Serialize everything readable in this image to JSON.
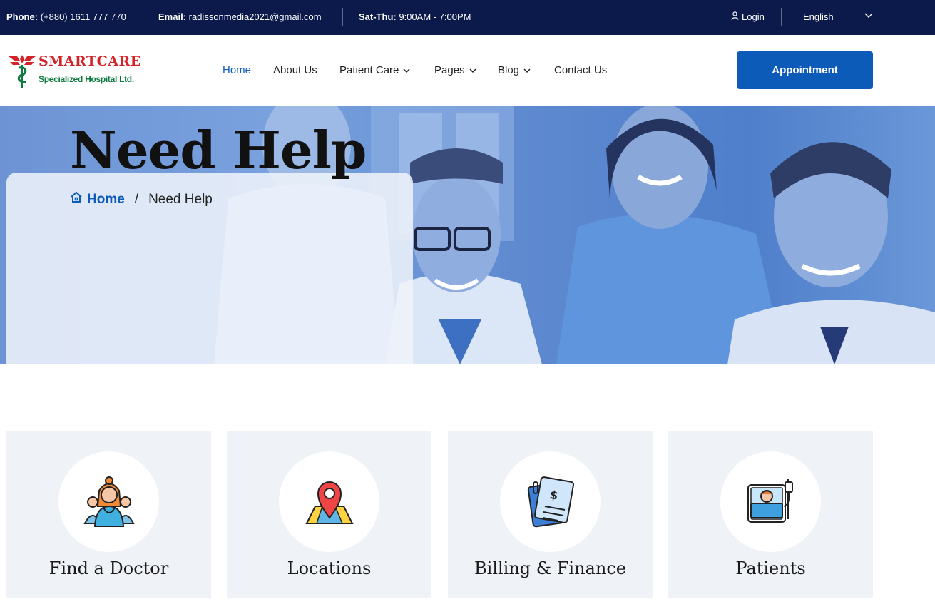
{
  "topbar": {
    "phone_label": "Phone:",
    "phone_value": "(+880) 1611 777 770",
    "email_label": "Email:",
    "email_value": "radissonmedia2021@gmail.com",
    "hours_label": "Sat-Thu:",
    "hours_value": "9:00AM - 7:00PM",
    "login": "Login",
    "language": "English"
  },
  "logo": {
    "brand": "SMARTCARE",
    "subtitle": "Specialized Hospital Ltd."
  },
  "nav": {
    "items": [
      {
        "label": "Home"
      },
      {
        "label": "About Us"
      },
      {
        "label": "Patient Care"
      },
      {
        "label": "Pages"
      },
      {
        "label": "Blog"
      },
      {
        "label": "Contact Us"
      }
    ]
  },
  "appointment_button": "Appointment",
  "hero": {
    "title": "Need Help",
    "breadcrumb_home": "Home",
    "breadcrumb_separator": "/",
    "breadcrumb_current": "Need Help"
  },
  "cards": [
    {
      "label": "Find a Doctor",
      "icon": "doctor-icon"
    },
    {
      "label": "Locations",
      "icon": "location-pin-icon"
    },
    {
      "label": "Billing & Finance",
      "icon": "billing-document-icon"
    },
    {
      "label": "Patients",
      "icon": "patient-bed-icon"
    }
  ],
  "colors": {
    "topbar_bg": "#0b1a4b",
    "accent": "#0d5bb8",
    "card_bg": "#eff2f6",
    "brand_red": "#d42229",
    "brand_green": "#0d7a3e"
  }
}
